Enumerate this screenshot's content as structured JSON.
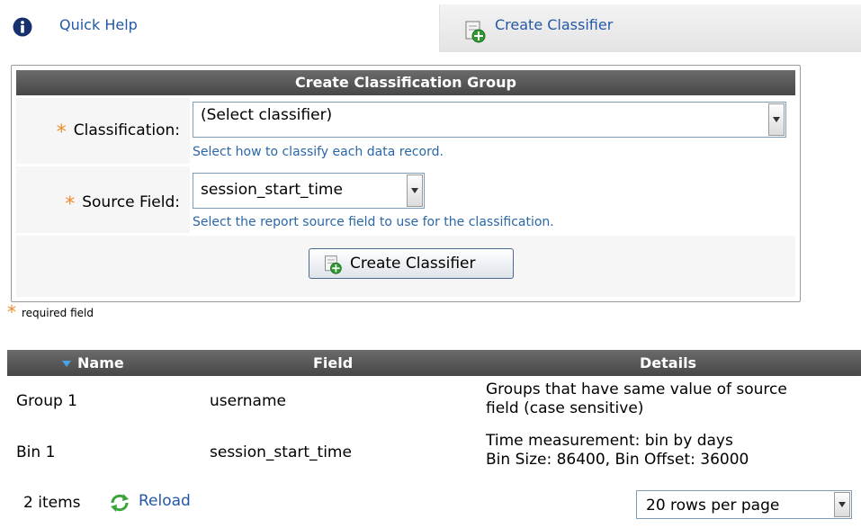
{
  "tabs": {
    "quick_help": "Quick Help",
    "create_classifier": "Create Classifier"
  },
  "form": {
    "title": "Create Classification Group",
    "classification": {
      "label": "Classification:",
      "selected": "(Select classifier)",
      "hint": "Select how to classify each data record."
    },
    "source_field": {
      "label": "Source Field:",
      "selected": "session_start_time",
      "hint": "Select the report source field to use for the classification."
    },
    "submit_label": "Create Classifier",
    "required_star": "*",
    "required_note": "required field"
  },
  "grid": {
    "columns": [
      "Name",
      "Field",
      "Details"
    ],
    "rows": [
      {
        "name": "Group 1",
        "field": "username",
        "details": [
          "Groups that have same value of source",
          "field (case sensitive)"
        ]
      },
      {
        "name": "Bin 1",
        "field": "session_start_time",
        "details": [
          "Time measurement: bin by days",
          "Bin Size: 86400, Bin Offset: 36000"
        ]
      }
    ],
    "item_count": "2 items",
    "reload_label": "Reload",
    "rows_per_page": "20 rows per page"
  },
  "icons": {
    "help": "info-icon",
    "create": "add-document-icon",
    "reload": "refresh-icon",
    "sort": "sort-desc-icon"
  },
  "colors": {
    "link": "#2458a6",
    "hint": "#2a67a7",
    "required": "#f08c2d",
    "header_bg": "#555555"
  }
}
